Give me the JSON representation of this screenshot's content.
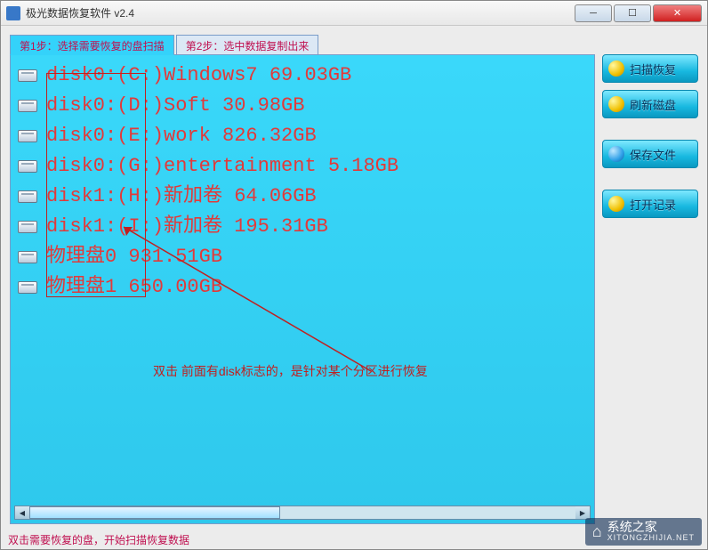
{
  "window": {
    "title": "极光数据恢复软件 v2.4"
  },
  "tabs": [
    {
      "label": "第1步：选择需要恢复的盘扫描",
      "active": true
    },
    {
      "label": "第2步：选中数据复制出来",
      "active": false
    }
  ],
  "disks": [
    {
      "text": "disk0:(C:)Windows7 69.03GB"
    },
    {
      "text": "disk0:(D:)Soft 30.98GB"
    },
    {
      "text": "disk0:(E:)work 826.32GB"
    },
    {
      "text": "disk0:(G:)entertainment 5.18GB"
    },
    {
      "text": "disk1:(H:)新加卷 64.06GB"
    },
    {
      "text": "disk1:(I:)新加卷 195.31GB"
    },
    {
      "text": "物理盘0 931.51GB"
    },
    {
      "text": "物理盘1 650.00GB"
    }
  ],
  "annotation": {
    "text": "双击 前面有disk标志的，是针对某个分区进行恢复"
  },
  "sidebar": {
    "scan": "扫描恢复",
    "refresh": "刷新磁盘",
    "save": "保存文件",
    "open": "打开记录"
  },
  "statusbar": {
    "text": "双击需要恢复的盘，开始扫描恢复数据"
  },
  "watermark": {
    "main": "系统之家",
    "sub": "XITONGZHIJIA.NET"
  }
}
